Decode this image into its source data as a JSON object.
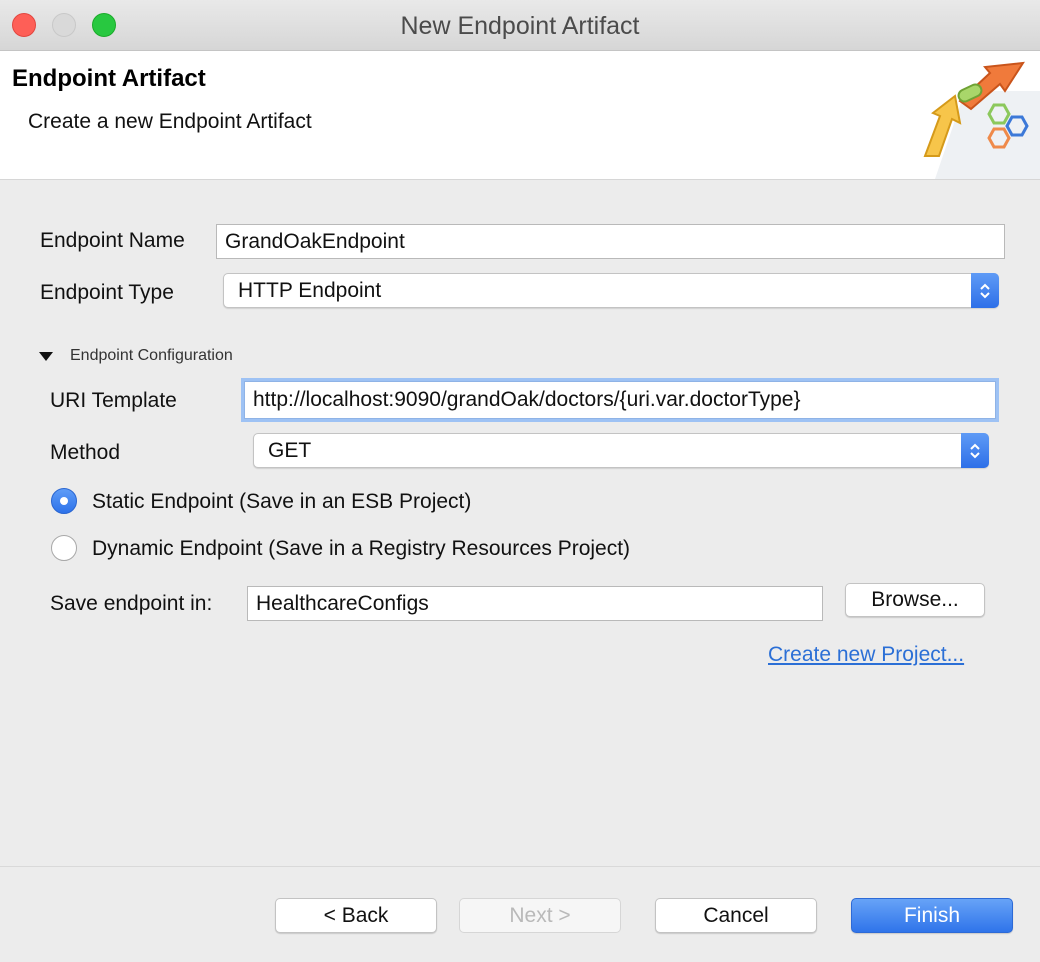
{
  "window": {
    "title": "New Endpoint Artifact"
  },
  "header": {
    "title": "Endpoint Artifact",
    "subtitle": "Create a new Endpoint Artifact",
    "graphic_icon": "wizard-arrow-graphic-icon"
  },
  "form": {
    "endpoint_name_label": "Endpoint Name",
    "endpoint_name_value": "GrandOakEndpoint",
    "endpoint_type_label": "Endpoint Type",
    "endpoint_type_value": "HTTP Endpoint"
  },
  "config": {
    "section_label": "Endpoint Configuration",
    "uri_template_label": "URI Template",
    "uri_template_value": "http://localhost:9090/grandOak/doctors/{uri.var.doctorType}",
    "method_label": "Method",
    "method_value": "GET",
    "static_option_label": "Static Endpoint (Save in an ESB Project)",
    "static_selected": true,
    "dynamic_option_label": "Dynamic Endpoint (Save in a Registry Resources Project)",
    "dynamic_selected": false,
    "save_in_label": "Save endpoint in:",
    "save_in_value": "HealthcareConfigs",
    "browse_label": "Browse...",
    "create_project_link": "Create new Project..."
  },
  "footer": {
    "back_label": "< Back",
    "next_label": "Next >",
    "cancel_label": "Cancel",
    "finish_label": "Finish"
  },
  "colors": {
    "accent": "#2f74ea",
    "link": "#2b6fd6",
    "close": "#fe5f57",
    "maximize": "#28c840"
  }
}
